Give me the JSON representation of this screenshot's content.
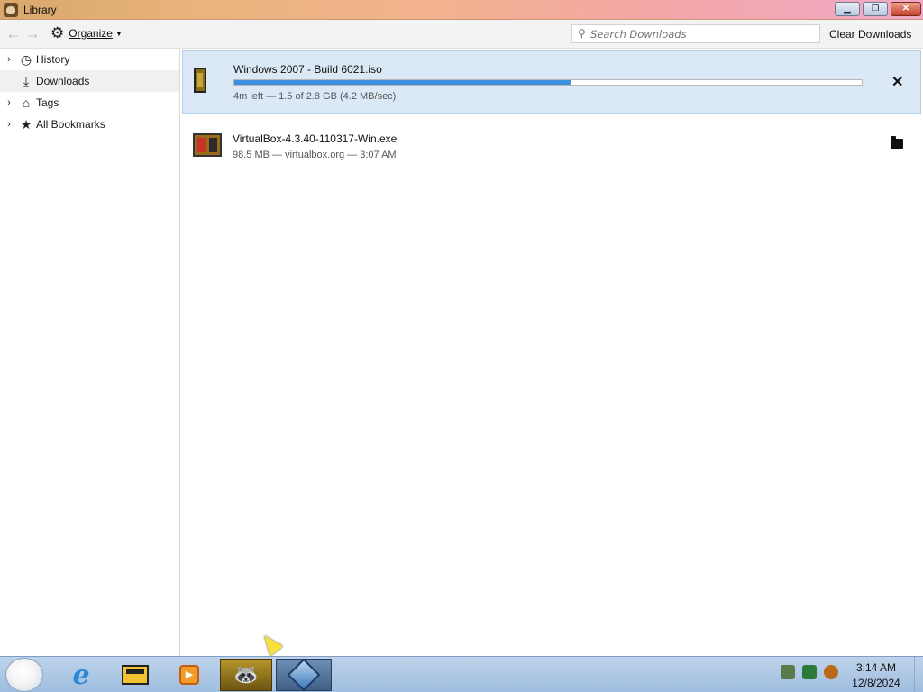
{
  "window": {
    "title": "Library",
    "minimize_icon": "minimize-icon",
    "maximize_icon": "restore-icon",
    "close_icon": "close-icon"
  },
  "toolbar": {
    "back_icon": "arrow-left-icon",
    "forward_icon": "arrow-right-icon",
    "organize_label": "Organize",
    "search_placeholder": "Search Downloads",
    "clear_label": "Clear Downloads"
  },
  "sidebar": {
    "items": [
      {
        "label": "History",
        "icon": "clock-icon",
        "expandable": true,
        "selected": false
      },
      {
        "label": "Downloads",
        "icon": "download-icon",
        "expandable": false,
        "selected": true
      },
      {
        "label": "Tags",
        "icon": "tag-icon",
        "expandable": true,
        "selected": false
      },
      {
        "label": "All Bookmarks",
        "icon": "star-icon",
        "expandable": true,
        "selected": false
      }
    ]
  },
  "downloads": [
    {
      "name": "Windows 2007 - Build 6021.iso",
      "status": "4m left — 1.5 of 2.8 GB (4.2 MB/sec)",
      "progress": 0.536,
      "state": "in-progress",
      "action_icon": "cancel-icon"
    },
    {
      "name": "VirtualBox-4.3.40-110317-Win.exe",
      "status": "98.5 MB — virtualbox.org — 3:07 AM",
      "state": "completed",
      "action_icon": "folder-icon"
    }
  ],
  "taskbar": {
    "start_icon": "windows-orb-icon",
    "pinned": [
      "internet-explorer-icon",
      "file-explorer-icon",
      "media-player-icon",
      "firefox-icon",
      "virtualbox-icon"
    ],
    "clock_time": "3:14 AM",
    "clock_date": "12/8/2024"
  },
  "colors": {
    "progress_fill": "#3d8fe0",
    "selected_row": "#dbe9f6"
  }
}
